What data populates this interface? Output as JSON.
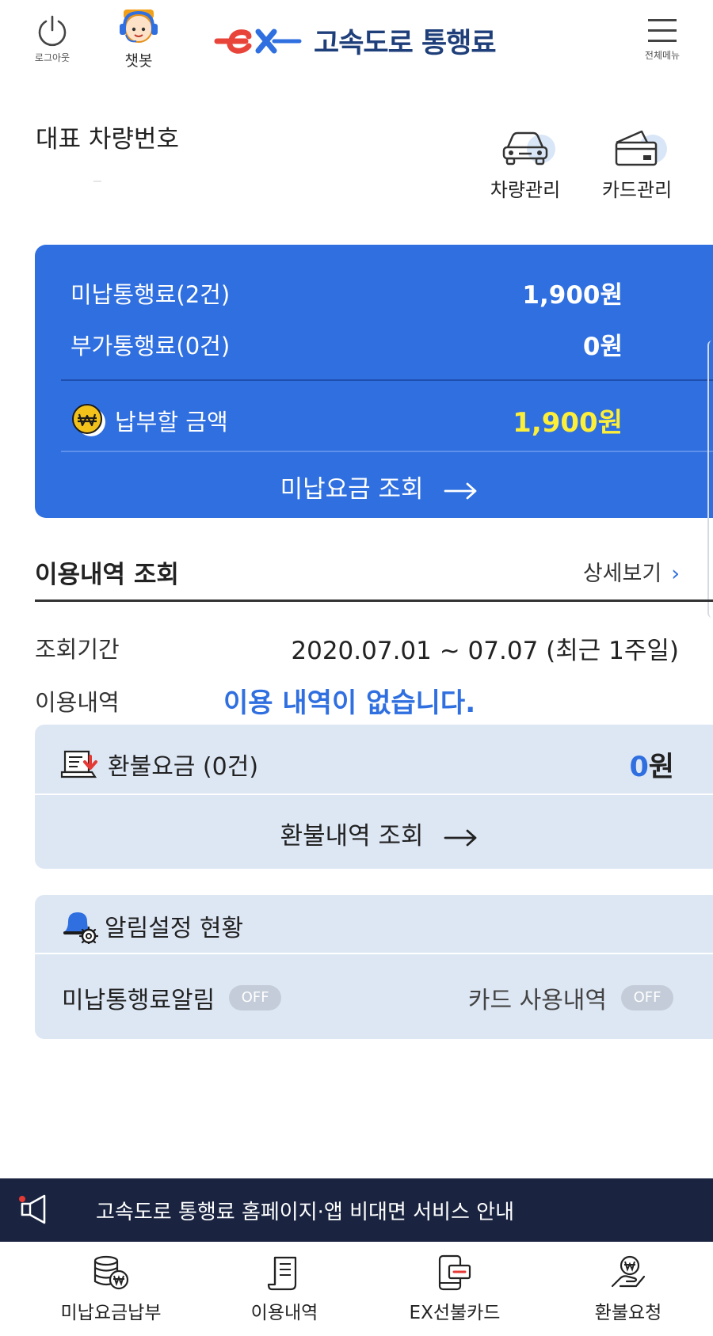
{
  "header": {
    "logout_label": "로그아웃",
    "chatbot_label": "챗봇",
    "brand_mark": "ex",
    "brand_title": "고속도로 통행료",
    "menu_label": "전체메뉴",
    "icons": {
      "logout": "power-icon",
      "chatbot": "chatbot-avatar-icon",
      "menu": "hamburger-menu-icon"
    }
  },
  "vehicle": {
    "title": "대표 차량번호",
    "number": "",
    "vehicle_manage_label": "차량관리",
    "card_manage_label": "카드관리",
    "icons": {
      "vehicle_manage": "car-icon",
      "card_manage": "card-icon"
    }
  },
  "toll": {
    "unpaid_label": "미납통행료(2건)",
    "unpaid_amount": "1,900원",
    "additional_label": "부가통행료(0건)",
    "additional_amount": "0원",
    "total_label": "납부할 금액",
    "total_amount": "1,900원",
    "unpaid_link": "미납요금 조회",
    "colors": {
      "card_bg": "#2f6fe0",
      "total_amount": "#fcef3a"
    },
    "icons": {
      "total": "won-coin-icon",
      "link": "arrow-right-icon"
    }
  },
  "usage": {
    "title": "이용내역 조회",
    "more_label": "상세보기",
    "more_chevron": "›",
    "period_label": "조회기간",
    "period_value": "2020.07.01 ~ 07.07 (최근 1주일)",
    "history_label": "이용내역",
    "history_empty": "이용 내역이 없습니다."
  },
  "refund": {
    "label": "환불요금 (0건)",
    "amount_num": "0",
    "amount_unit": "원",
    "link": "환불내역 조회",
    "icons": {
      "refund": "refund-document-icon",
      "link": "arrow-right-icon"
    }
  },
  "alerts": {
    "title": "알림설정 현황",
    "unpaid_alert_label": "미납통행료알림",
    "unpaid_alert_state": "OFF",
    "card_usage_label": "카드 사용내역",
    "card_usage_state": "OFF",
    "icons": {
      "title": "bell-gear-icon"
    }
  },
  "notice": {
    "text": "고속도로 통행료 홈페이지·앱 비대면 서비스 안내",
    "icon": "megaphone-icon"
  },
  "bottom_nav": [
    {
      "label": "미납요금납부",
      "icon": "coin-stack-won-icon"
    },
    {
      "label": "이용내역",
      "icon": "receipt-icon"
    },
    {
      "label": "EX선불카드",
      "icon": "phone-card-icon"
    },
    {
      "label": "환불요청",
      "icon": "hand-won-icon"
    }
  ]
}
